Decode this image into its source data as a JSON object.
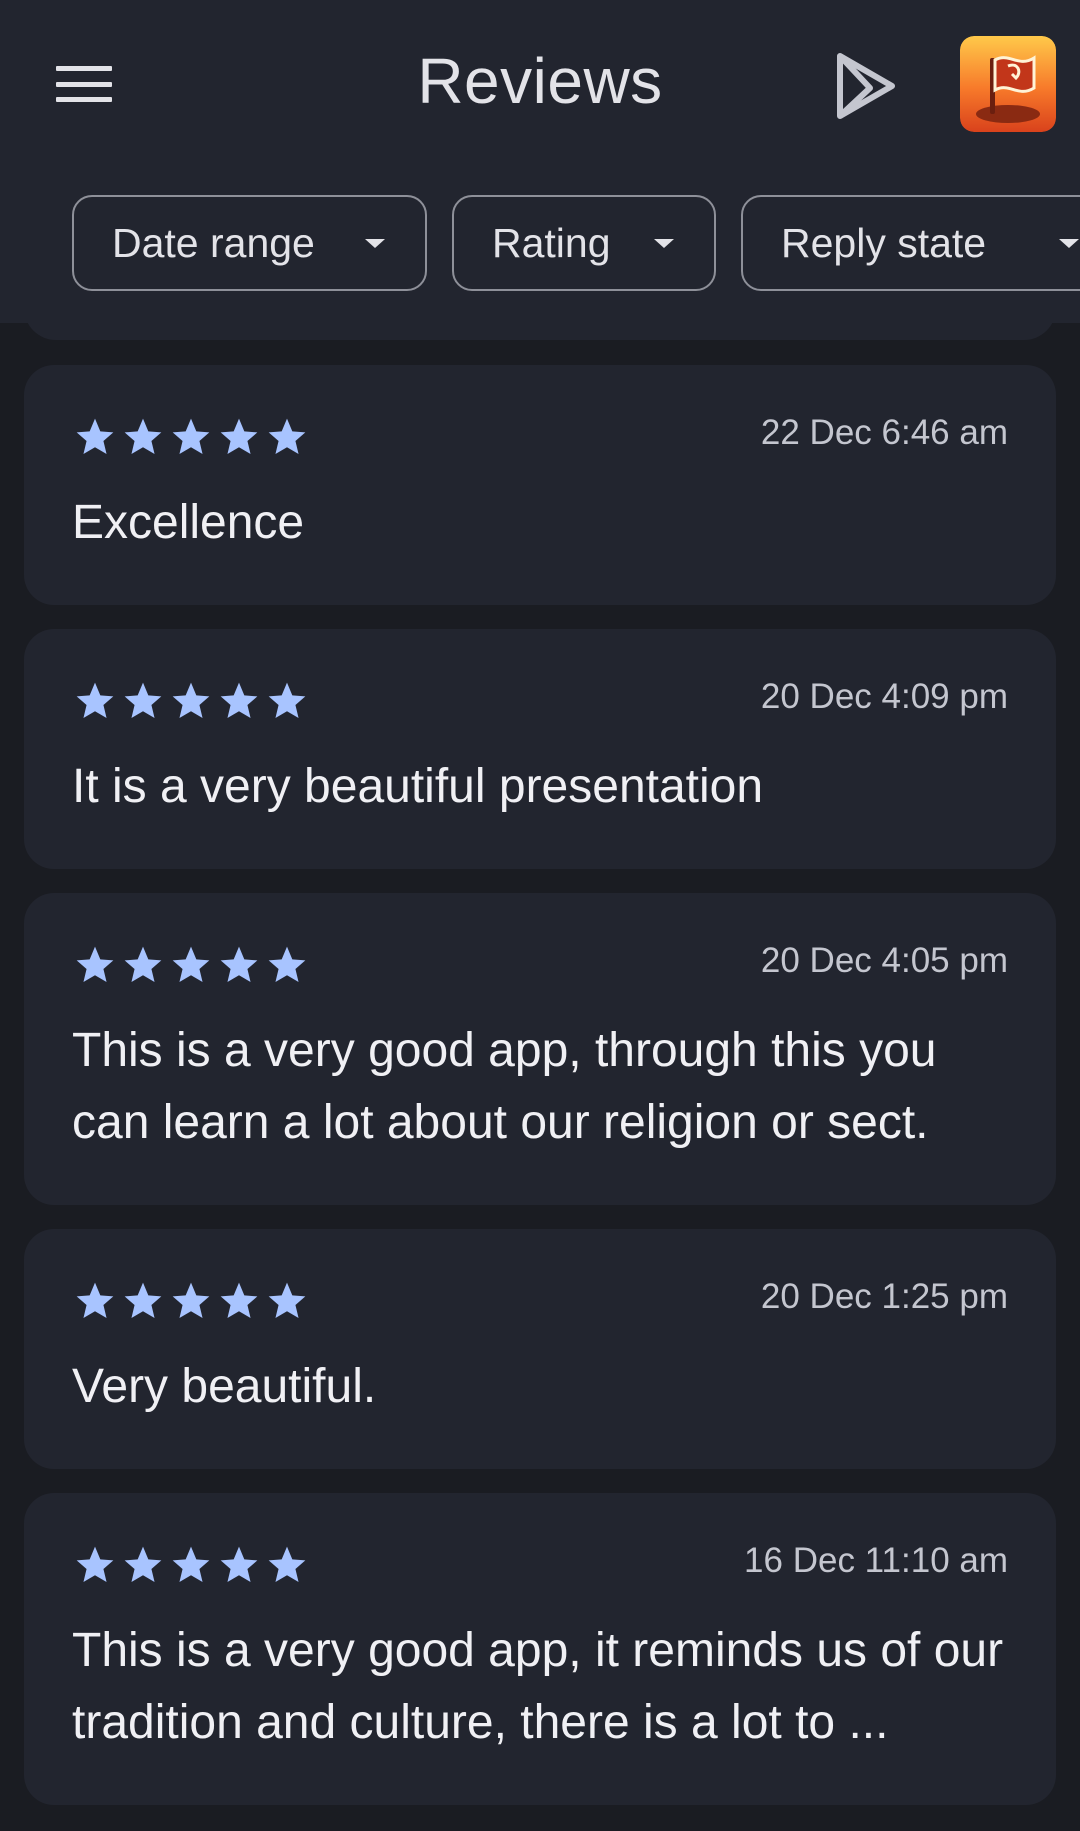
{
  "header": {
    "title": "Reviews",
    "menu_icon": "hamburger-menu-icon",
    "play_icon": "google-play-icon",
    "app_icon": "app-flag-icon"
  },
  "filters": [
    {
      "label": "Date range"
    },
    {
      "label": "Rating"
    },
    {
      "label": "Reply state"
    }
  ],
  "colors": {
    "background": "#1a1c22",
    "surface": "#22252f",
    "star": "#a8c4ff",
    "text": "#f0f0f4",
    "muted": "#c4c6cf"
  },
  "reviews": [
    {
      "rating": 5,
      "date": "22 Dec 6:46 am",
      "text": "Excellence"
    },
    {
      "rating": 5,
      "date": "20 Dec 4:09 pm",
      "text": "It is a very beautiful presentation"
    },
    {
      "rating": 5,
      "date": "20 Dec 4:05 pm",
      "text": "This is a very good app, through this you can learn a lot about our religion or sect."
    },
    {
      "rating": 5,
      "date": "20 Dec 1:25 pm",
      "text": "Very beautiful."
    },
    {
      "rating": 5,
      "date": "16 Dec 11:10 am",
      "text": "This is a very good app, it reminds us of our tradition and culture, there is a lot to ..."
    }
  ]
}
